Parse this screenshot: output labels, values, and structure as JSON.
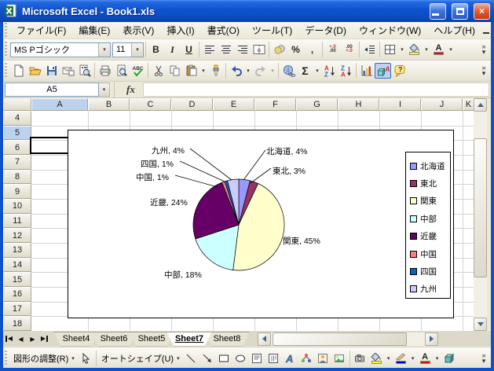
{
  "window": {
    "title": "Microsoft Excel - Book1.xls"
  },
  "menu": {
    "items": [
      "ファイル(F)",
      "編集(E)",
      "表示(V)",
      "挿入(I)",
      "書式(O)",
      "ツール(T)",
      "データ(D)",
      "ウィンドウ(W)",
      "ヘルプ(H)"
    ]
  },
  "formatting_toolbar": {
    "font_name": "MS Pゴシック",
    "font_size": "11"
  },
  "formula_bar": {
    "name_box": "A5",
    "fx_label": "fx"
  },
  "grid": {
    "columns": [
      "A",
      "B",
      "C",
      "D",
      "E",
      "F",
      "G",
      "H",
      "I",
      "J",
      "K"
    ],
    "rows": [
      "4",
      "5",
      "6",
      "7",
      "8",
      "9",
      "10",
      "11",
      "12",
      "13",
      "14",
      "15",
      "16",
      "17",
      "18"
    ],
    "selected_column": "A",
    "selected_row": "5",
    "selected_cell": "A5"
  },
  "chart_data": {
    "type": "pie",
    "title": "",
    "categories": [
      "北海道",
      "東北",
      "関東",
      "中部",
      "近畿",
      "中国",
      "四国",
      "九州"
    ],
    "values": [
      4,
      3,
      45,
      18,
      24,
      1,
      1,
      4
    ],
    "unit": "%",
    "colors": [
      "#9999FF",
      "#993366",
      "#FFFFCC",
      "#CCFFFF",
      "#660066",
      "#FF8080",
      "#0066CC",
      "#CCCCFF"
    ],
    "labels": [
      "北海道, 4%",
      "東北, 3%",
      "関東, 45%",
      "中部, 18%",
      "近畿, 24%",
      "中国, 1%",
      "四国, 1%",
      "九州, 4%"
    ],
    "legend_position": "right",
    "start_angle_deg": 0,
    "direction": "clockwise"
  },
  "sheet_tabs": {
    "tabs": [
      "Sheet4",
      "Sheet6",
      "Sheet5",
      "Sheet7",
      "Sheet8"
    ],
    "active": "Sheet7"
  },
  "drawing_toolbar": {
    "adjust_label": "図形の調整(R)",
    "autoshape_label": "オートシェイプ(U)"
  },
  "icons": {
    "bold": "B",
    "italic": "I",
    "underline": "U",
    "percent": "%",
    "comma": ",",
    "autosum": "Σ",
    "chevron": "»",
    "dropdown": "▾",
    "spelling_abc": "ABC",
    "letter_a": "A",
    "letter_z": "Z",
    "letter_a_lower": "a",
    "close": "×",
    "nav_prev": "◀",
    "nav_next": "▶",
    "help_qm": "?"
  }
}
